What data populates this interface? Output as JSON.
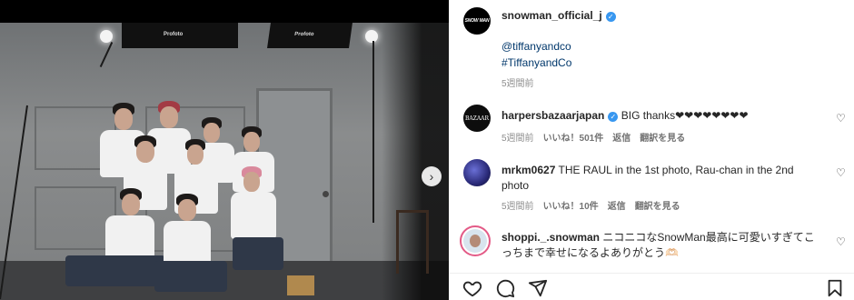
{
  "post": {
    "username": "snowman_official_j",
    "avatar_text": "SNOW MAN",
    "caption_lines": [
      "@tiffanyandco",
      "#TiffanyandCo"
    ],
    "time": "5週間前"
  },
  "photo": {
    "softbox_left_label": "Profoto",
    "softbox_right_label": "Profoto"
  },
  "comments": [
    {
      "username": "harpersbazaarjapan",
      "verified": true,
      "avatar_text": "BAZAAR",
      "text": "BIG thanks❤❤❤❤❤❤❤❤",
      "time": "5週間前",
      "likes": "いいね！501件",
      "reply": "返信",
      "translate": "翻訳を見る"
    },
    {
      "username": "mrkm0627",
      "verified": false,
      "text": "THE RAUL in the 1st photo, Rau-chan in the 2nd photo",
      "time": "5週間前",
      "likes": "いいね！10件",
      "reply": "返信",
      "translate": "翻訳を見る"
    },
    {
      "username": "shoppi._.snowman",
      "verified": false,
      "text": "ニコニコなSnowMan最高に可愛いすぎてこっちまで幸せになるよありがとう🫶🏻",
      "time": "",
      "likes": "",
      "reply": "",
      "translate": ""
    }
  ],
  "icons": {
    "verified": "verified-badge-icon",
    "like": "heart-icon",
    "comment": "comment-icon",
    "share": "share-icon",
    "save": "bookmark-icon",
    "next": "chevron-right-icon"
  },
  "colors": {
    "link": "#00376b",
    "verified": "#3897f0",
    "muted": "#8e8e8e",
    "story_ring": "#e35b87"
  }
}
